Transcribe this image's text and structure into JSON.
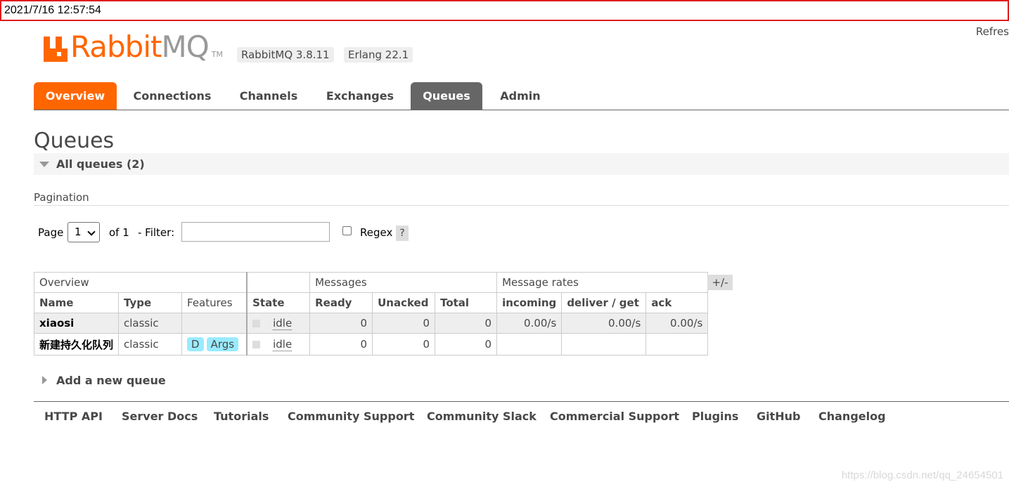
{
  "timestamp": "2021/7/16 12:57:54",
  "header": {
    "logo_rabbit": "Rabbit",
    "logo_mq": "MQ",
    "logo_tm": "TM",
    "rabbitmq_version": "RabbitMQ 3.8.11",
    "erlang_version": "Erlang 22.1",
    "refresh_label": "Refres"
  },
  "tabs": [
    "Overview",
    "Connections",
    "Channels",
    "Exchanges",
    "Queues",
    "Admin"
  ],
  "active_tab": "Queues",
  "page_title": "Queues",
  "section": {
    "label": "All queues (2)"
  },
  "pagination": {
    "label": "Pagination",
    "page_label": "Page",
    "page_value": "1",
    "of_label": "of 1",
    "filter_label": "- Filter:",
    "filter_value": "",
    "regex_label": "Regex",
    "regex_checked": false,
    "help_label": "?"
  },
  "table": {
    "groups": [
      "Overview",
      "Messages",
      "Message rates"
    ],
    "columns": [
      "Name",
      "Type",
      "Features",
      "State",
      "Ready",
      "Unacked",
      "Total",
      "incoming",
      "deliver / get",
      "ack"
    ],
    "rows": [
      {
        "name": "xiaosi",
        "type": "classic",
        "features": [],
        "state": "idle",
        "ready": "0",
        "unacked": "0",
        "total": "0",
        "incoming": "0.00/s",
        "deliver_get": "0.00/s",
        "ack": "0.00/s"
      },
      {
        "name": "新建持久化队列",
        "type": "classic",
        "features": [
          "D",
          "Args"
        ],
        "state": "idle",
        "ready": "0",
        "unacked": "0",
        "total": "0",
        "incoming": "",
        "deliver_get": "",
        "ack": ""
      }
    ],
    "toggle_columns_label": "+/-"
  },
  "add_queue_label": "Add a new queue",
  "footer_links": [
    "HTTP API",
    "Server Docs",
    "Tutorials",
    "Community Support",
    "Community Slack",
    "Commercial Support",
    "Plugins",
    "GitHub",
    "Changelog"
  ],
  "watermark": "https://blog.csdn.net/qq_24654501",
  "colors": {
    "brand_orange": "#ff6600",
    "active_tab_grey": "#666666",
    "feature_badge": "#99ebff",
    "timestamp_border": "#e01b1b"
  }
}
